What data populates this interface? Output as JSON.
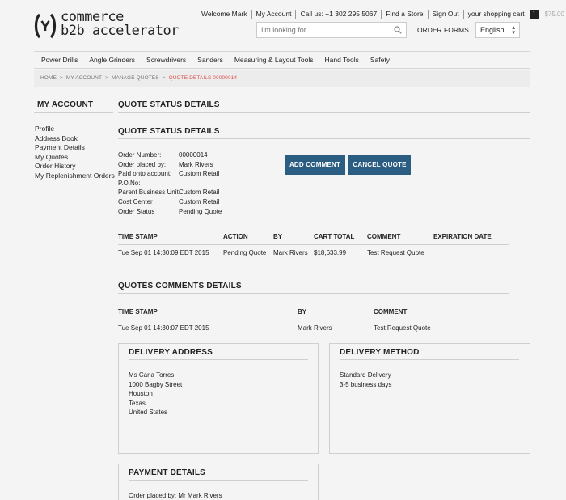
{
  "logo": {
    "line1": "commerce",
    "line2": "b2b accelerator"
  },
  "header": {
    "welcome": "Welcome Mark",
    "my_account": "My Account",
    "call_us": "Call us: +1 302 295 5067",
    "find_store": "Find a Store",
    "sign_out": "Sign Out",
    "cart_label": "your shopping cart",
    "cart_count": "1",
    "cart_total": "$75.00",
    "search_placeholder": "I'm looking for",
    "order_forms": "ORDER FORMS",
    "language": "English"
  },
  "nav": [
    "Power Drills",
    "Angle Grinders",
    "Screwdrivers",
    "Sanders",
    "Measuring & Layout Tools",
    "Hand Tools",
    "Safety"
  ],
  "breadcrumb": {
    "home": "HOME",
    "account": "MY ACCOUNT",
    "quotes": "MANAGE QUOTES",
    "current": "QUOTE DETAILS 00000014",
    "sep": ">"
  },
  "sidebar": {
    "title": "MY ACCOUNT",
    "items": [
      "Profile",
      "Address Book",
      "Payment Details",
      "My Quotes",
      "Order History",
      "My Replenishment Orders"
    ]
  },
  "main": {
    "title": "QUOTE STATUS DETAILS",
    "subtitle": "QUOTE STATUS DETAILS",
    "info": [
      {
        "k": "Order Number:",
        "v": "00000014"
      },
      {
        "k": "Order placed by:",
        "v": "Mark Rivers"
      },
      {
        "k": "Paid onto account:",
        "v": "Custom Retail"
      },
      {
        "k": "P.O.No:",
        "v": ""
      },
      {
        "k": "Parent Business Unit:",
        "v": "Custom Retail"
      },
      {
        "k": "Cost Center",
        "v": "Custom Retail"
      },
      {
        "k": "Order Status",
        "v": "Pending Quote"
      }
    ],
    "add_comment": "ADD COMMENT",
    "cancel_quote": "CANCEL QUOTE"
  },
  "status_table": {
    "headers": {
      "time": "TIME STAMP",
      "action": "ACTION",
      "by": "BY",
      "total": "CART TOTAL",
      "comment": "COMMENT",
      "expiration": "EXPIRATION DATE"
    },
    "row": {
      "time": "Tue Sep 01 14:30:09 EDT 2015",
      "action": "Pending Quote",
      "by": "Mark Rivers",
      "total": "$18,633.99",
      "comment": "Test Request Quote",
      "expiration": ""
    }
  },
  "comments": {
    "title": "QUOTES COMMENTS DETAILS",
    "headers": {
      "time": "TIME STAMP",
      "by": "BY",
      "comment": "COMMENT"
    },
    "row": {
      "time": "Tue Sep 01 14:30:07 EDT 2015",
      "by": "Mark Rivers",
      "comment": "Test Request Quote"
    }
  },
  "delivery_address": {
    "title": "DELIVERY ADDRESS",
    "lines": [
      "Ms Carla Torres",
      "1000 Bagby Street",
      "Houston",
      "Texas",
      "United States"
    ]
  },
  "delivery_method": {
    "title": "DELIVERY METHOD",
    "lines": [
      "Standard Delivery",
      "3-5 business days"
    ]
  },
  "payment": {
    "title": "PAYMENT DETAILS",
    "lines": [
      "Order placed by: Mr Mark Rivers"
    ]
  },
  "colors": {
    "accent": "#2b5d83",
    "breadcrumb_current": "#d9534f"
  },
  "icons": {
    "search": "search-icon",
    "logo": "logo-mark-icon",
    "dropdown": "chevron-down-icon"
  }
}
